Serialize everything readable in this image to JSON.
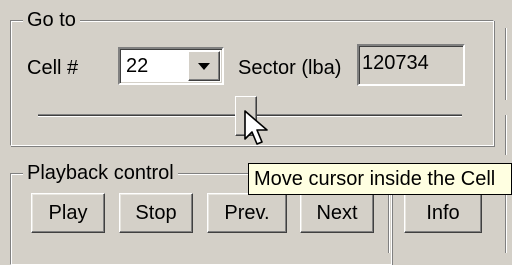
{
  "goto": {
    "legend": "Go to",
    "cell_label": "Cell #",
    "cell_value": "22",
    "sector_label": "Sector (lba)",
    "sector_value": "120734",
    "slider_position": 0.49
  },
  "playback": {
    "legend": "Playback control",
    "buttons": {
      "play": "Play",
      "stop": "Stop",
      "prev": "Prev.",
      "next": "Next"
    }
  },
  "info_button": "Info",
  "tooltip": "Move cursor inside the Cell",
  "icons": {
    "dropdown": "chevron-down-icon",
    "cursor": "mouse-pointer-icon"
  },
  "colors": {
    "face": "#d4d0c8",
    "tooltip_bg": "#ffffe1",
    "shadow": "#808080",
    "highlight": "#ffffff"
  }
}
